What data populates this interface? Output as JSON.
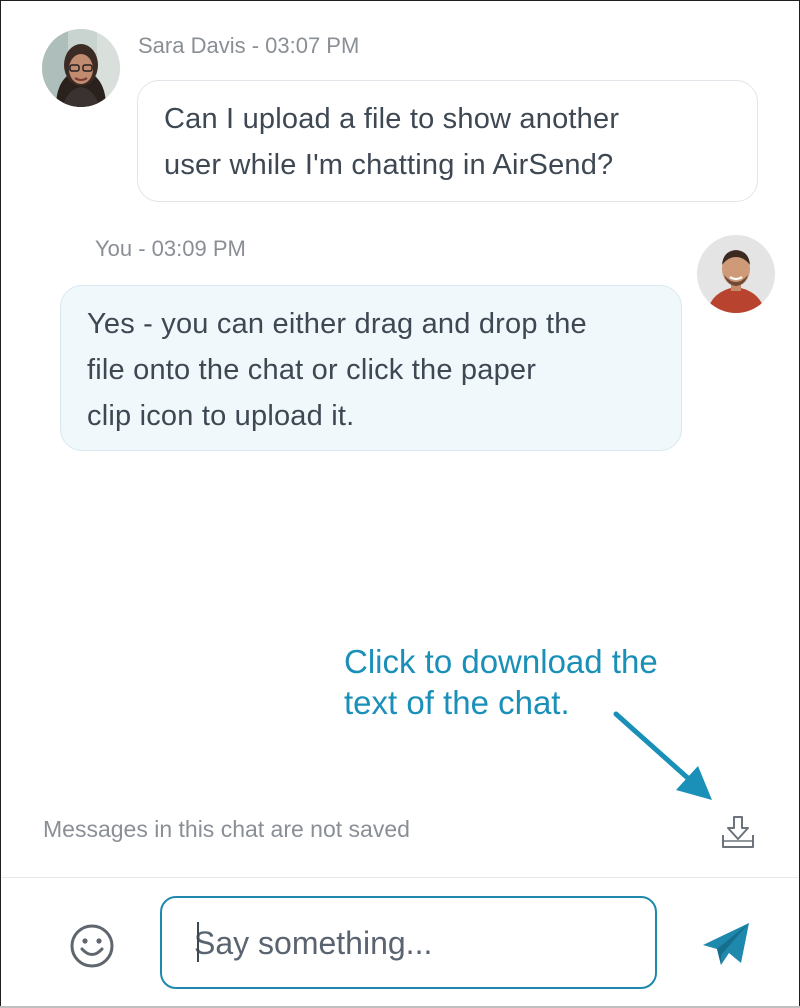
{
  "messages": [
    {
      "sender": "Sara Davis",
      "time": "03:07 PM",
      "meta": "Sara Davis - 03:07 PM",
      "lines": [
        "Can I upload a file to show another",
        "user while I'm chatting in AirSend?"
      ]
    },
    {
      "sender": "You",
      "time": "03:09 PM",
      "meta": "You - 03:09 PM",
      "lines": [
        "Yes - you can either drag and drop the",
        "file onto the chat or click the paper",
        "clip icon to upload it."
      ]
    }
  ],
  "annotation": {
    "lines": [
      "Click to download the",
      "text of the chat."
    ]
  },
  "notice": "Messages in this chat are not saved",
  "icons": {
    "download": "download-tray-icon",
    "emoji": "smiley-face-icon",
    "send": "paper-plane-icon",
    "arrow": "callout-arrow"
  },
  "composer": {
    "placeholder": "Say something...",
    "value": ""
  },
  "colors": {
    "accent": "#1e88ad",
    "annotation": "#1a8fb8",
    "my_bubble": "#f1f8fb",
    "muted_text": "#8a8f96",
    "body_text": "#3e4853"
  }
}
